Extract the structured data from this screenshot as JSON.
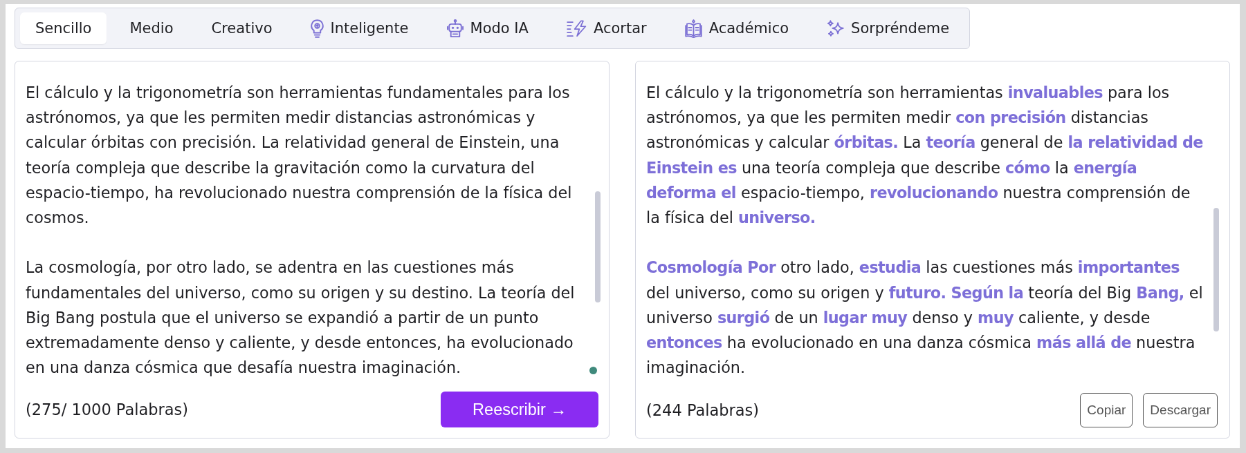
{
  "tabs": [
    {
      "label": "Sencillo",
      "selected": true
    },
    {
      "label": "Medio",
      "selected": false
    },
    {
      "label": "Creativo",
      "selected": false
    },
    {
      "label": "Inteligente",
      "selected": false
    },
    {
      "label": "Modo IA",
      "selected": false
    },
    {
      "label": "Acortar",
      "selected": false
    },
    {
      "label": "Académico",
      "selected": false
    },
    {
      "label": "Sorpréndeme",
      "selected": false
    }
  ],
  "input_panel": {
    "paragraphs": [
      "El cálculo y la trigonometría son herramientas fundamentales para los astrónomos, ya que les permiten medir distancias astronómicas y calcular órbitas con precisión. La relatividad general de Einstein, una teoría compleja que describe la gravitación como la curvatura del espacio-tiempo, ha revolucionado nuestra comprensión de la física del cosmos.",
      "La cosmología, por otro lado, se adentra en las cuestiones más fundamentales del universo, como su origen y su destino. La teoría del Big Bang postula que el universo se expandió a partir de un punto extremadamente denso y caliente, y desde entonces, ha evolucionado en una danza cósmica que desafía nuestra imaginación."
    ],
    "word_count": "(275/ 1000 Palabras)",
    "rewrite_button": "Reescribir →"
  },
  "output_panel": {
    "paragraphs": [
      "El cálculo y la trigonometría son herramientas **invaluables** para los astrónomos, ya que les permiten medir **con precisión** distancias astronómicas y calcular **órbitas.** La **teoría** general de **la relatividad de Einstein es** una teoría compleja que describe **cómo** la **energía deforma el** espacio-tiempo, **revolucionando** nuestra comprensión de la física del **universo.**",
      "**Cosmología Por** otro lado, **estudia** las cuestiones más **importantes** del universo, como su origen y **futuro. Según la** teoría del Big **Bang,** el universo **surgió** de un **lugar muy** denso y **muy** caliente, y desde **entonces** ha evolucionado en una danza cósmica **más allá de** nuestra imaginación."
    ],
    "word_count": "(244 Palabras)",
    "buttons": [
      "Copiar",
      "Descargar"
    ]
  }
}
